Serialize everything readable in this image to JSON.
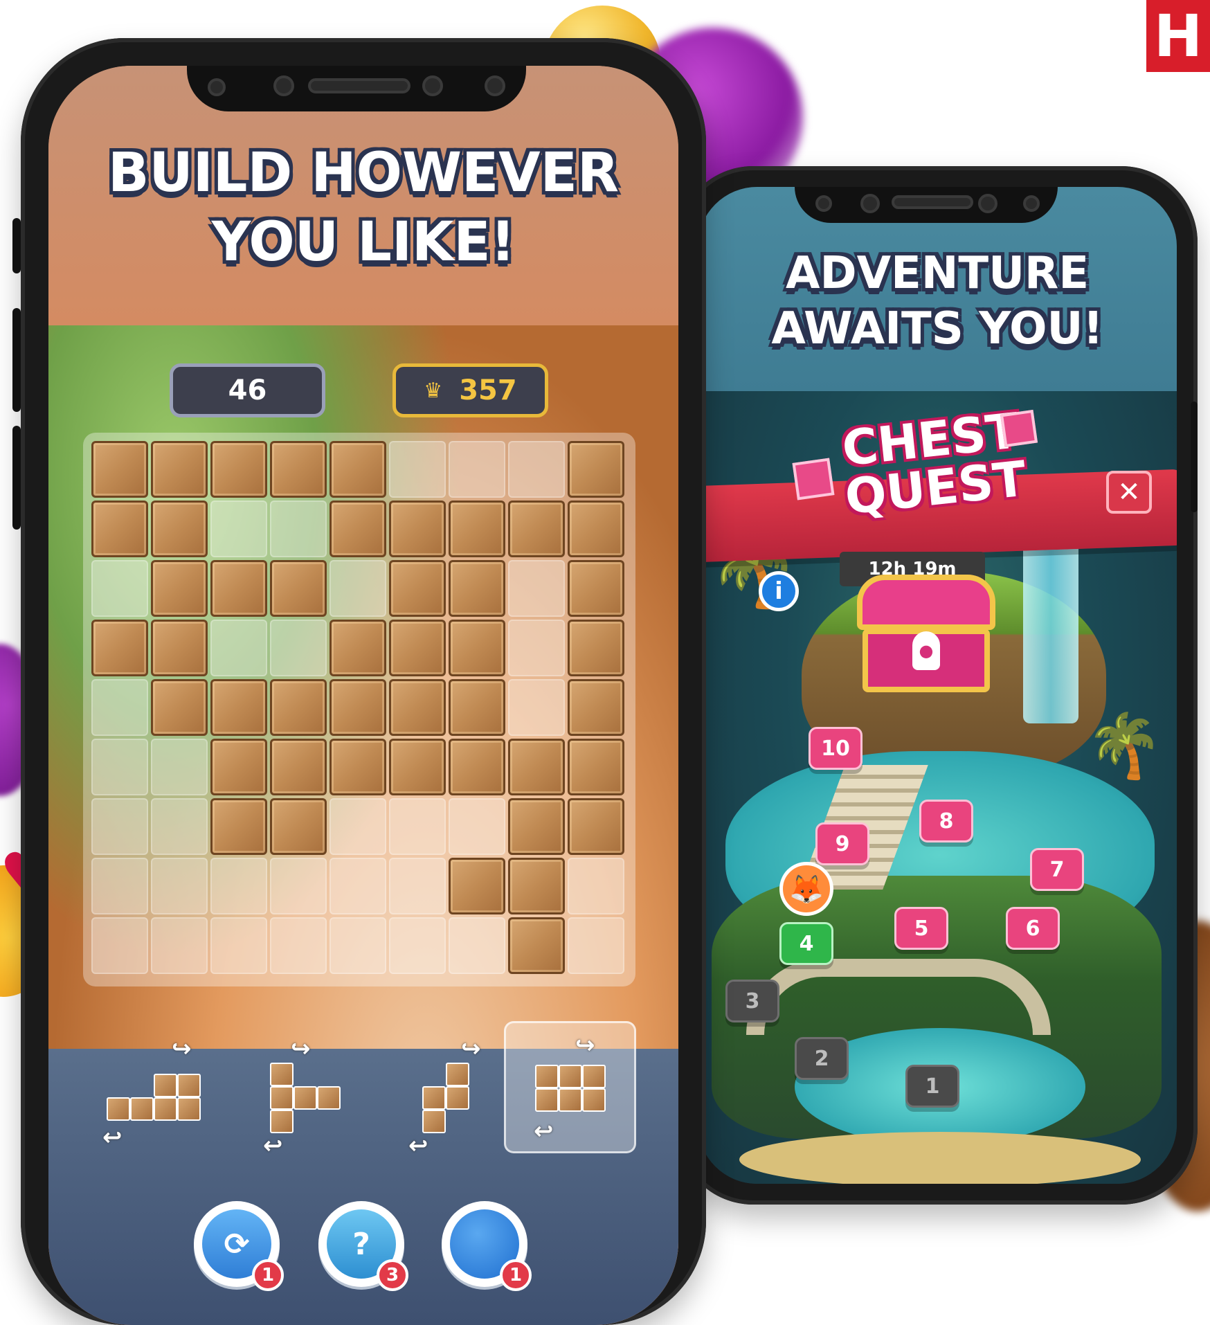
{
  "brand": {
    "logo_letter": "H",
    "color": "#d81e2a"
  },
  "left_phone": {
    "headline_line1": "BUILD HOWEVER",
    "headline_line2": "YOU LIKE!",
    "score": "46",
    "best_icon": "crown-icon",
    "best_score": "357",
    "grid": [
      "WWWWW...W",
      "WW..WWWWW",
      ".WWW.WW.W",
      "WW..WWW.W",
      ".WWWWWW.W",
      "..WWWWWWW",
      "..WW...WW",
      "......WW.",
      ".......W."
    ],
    "pieces": [
      "L-piece",
      "T-piece",
      "S-piece",
      "2x3-block"
    ],
    "boosters": [
      {
        "name": "rotate-booster",
        "count": "1"
      },
      {
        "name": "mystery-bag-booster",
        "count": "3"
      },
      {
        "name": "bomb-booster",
        "count": "1"
      }
    ]
  },
  "right_phone": {
    "headline_line1": "ADVENTURE",
    "headline_line2": "AWAITS YOU!",
    "event_title_line1": "CHEST",
    "event_title_line2": "QUEST",
    "timer": "12h 19m",
    "close_label": "✕",
    "info_label": "i",
    "levels": [
      {
        "n": "1",
        "state": "locked"
      },
      {
        "n": "2",
        "state": "locked"
      },
      {
        "n": "3",
        "state": "locked"
      },
      {
        "n": "4",
        "state": "current"
      },
      {
        "n": "5",
        "state": "open"
      },
      {
        "n": "6",
        "state": "open"
      },
      {
        "n": "7",
        "state": "open"
      },
      {
        "n": "8",
        "state": "open"
      },
      {
        "n": "9",
        "state": "open"
      },
      {
        "n": "10",
        "state": "open"
      }
    ]
  }
}
